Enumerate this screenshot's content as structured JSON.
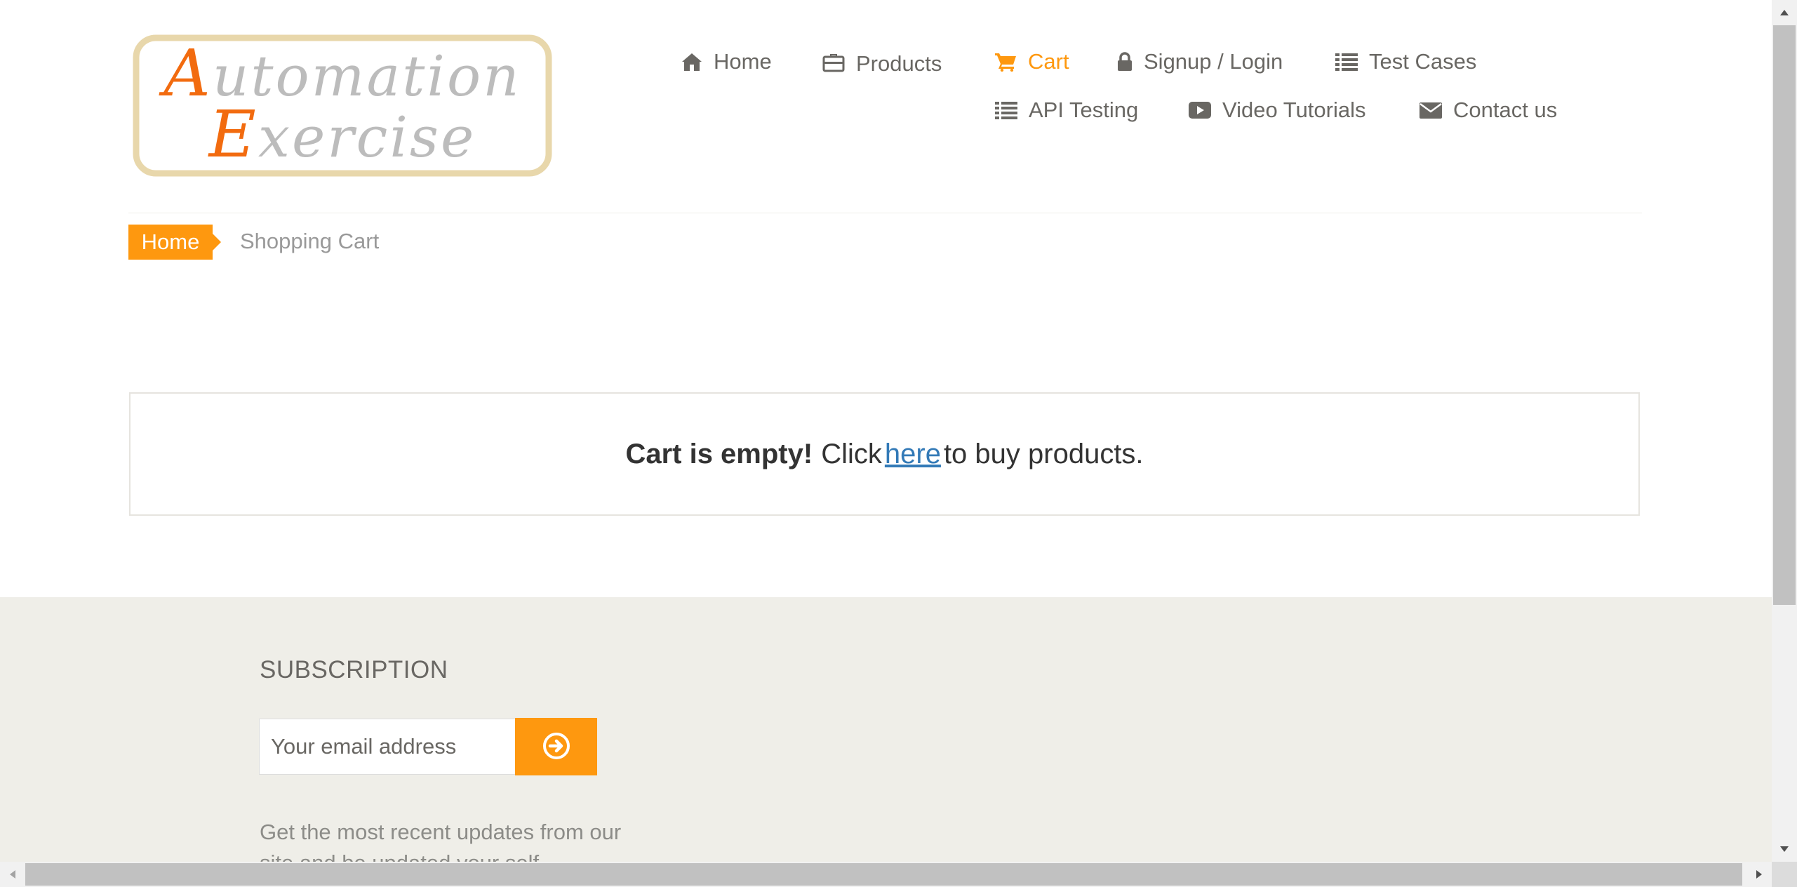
{
  "header": {
    "logo_line1": "Automation",
    "logo_line2": "Exercise",
    "nav": [
      {
        "label": "Home",
        "icon": "home-icon"
      },
      {
        "label": "Products",
        "icon": "briefcase-icon"
      },
      {
        "label": "Cart",
        "icon": "shopping-cart-icon",
        "active": true
      },
      {
        "label": "Signup / Login",
        "icon": "lock-icon"
      },
      {
        "label": "Test Cases",
        "icon": "list-icon"
      },
      {
        "label": "API Testing",
        "icon": "list-icon"
      },
      {
        "label": "Video Tutorials",
        "icon": "youtube-play-icon"
      },
      {
        "label": "Contact us",
        "icon": "envelope-icon"
      }
    ]
  },
  "breadcrumb": {
    "home": "Home",
    "current": "Shopping Cart"
  },
  "cart": {
    "empty_bold": "Cart is empty!",
    "click_text": "Click",
    "link_text": "here",
    "after_text": "to buy products."
  },
  "footer": {
    "subscription_title": "SUBSCRIPTION",
    "email_placeholder": "Your email address",
    "subscribe_icon": "arrow-circle-right-icon",
    "description": "Get the most recent updates from our site and be updated your self..."
  },
  "colors": {
    "accent": "#FE980F",
    "nav_text": "#696763",
    "link": "#337ab7",
    "footer_bg": "#efeee8"
  }
}
